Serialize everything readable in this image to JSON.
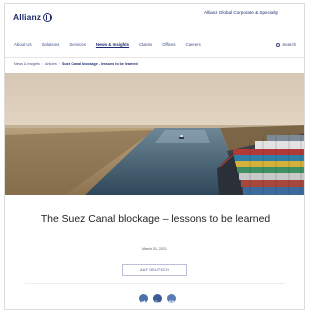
{
  "header": {
    "logo_text": "Allianz",
    "brand_name": "Allianz Global Corporate & Specialty"
  },
  "nav": {
    "items": [
      "About Us",
      "Solutions",
      "Services",
      "News & Insights",
      "Claims",
      "Offices",
      "Careers"
    ],
    "active_index": 3,
    "search_label": "Search"
  },
  "breadcrumb": {
    "items": [
      "News & Insights",
      "Articles",
      "Suez Canal blockage - lessons to be learned"
    ]
  },
  "hero": {
    "image_alt": "Container ship in the Suez Canal"
  },
  "article": {
    "title": "The Suez Canal blockage – lessons to be learned",
    "date": "March 31, 2021",
    "language_button": "AUF DEUTSCH"
  },
  "share": {
    "icons": [
      "twitter-icon",
      "linkedin-icon",
      "email-icon"
    ]
  },
  "colors": {
    "brand_blue": "#1f2b6f",
    "link_blue": "#3d4a84",
    "share_blue": "#4b6fa8"
  }
}
